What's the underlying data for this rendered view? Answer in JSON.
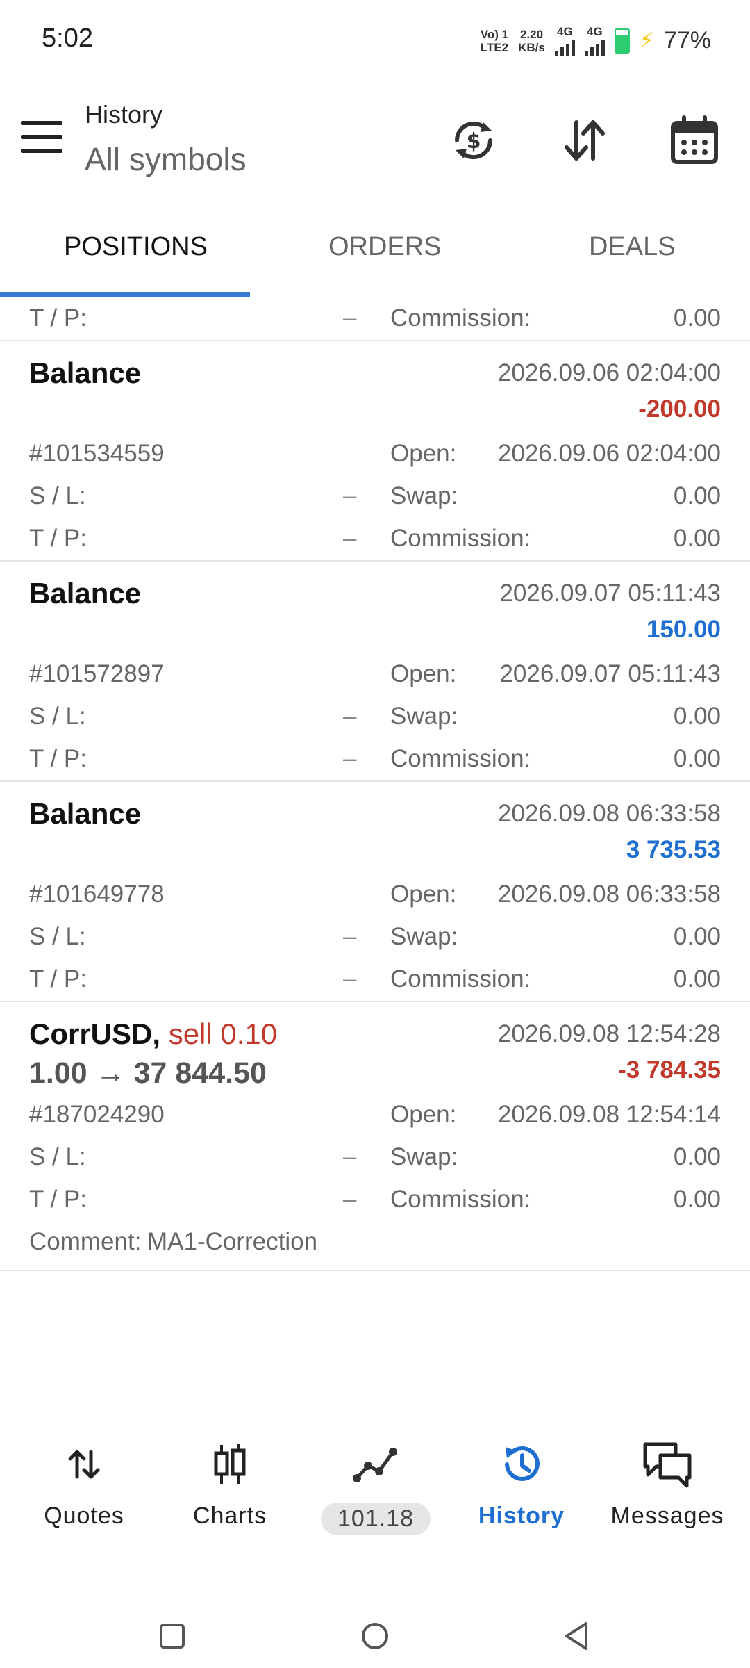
{
  "status": {
    "time": "5:02",
    "net1": "Vo) 1",
    "net1b": "LTE2",
    "speed": "2.20",
    "speed_unit": "KB/s",
    "net2": "4G",
    "net3": "4G",
    "battery_pct": "77%"
  },
  "header": {
    "title": "History",
    "subtitle": "All symbols"
  },
  "tabs": [
    "POSITIONS",
    "ORDERS",
    "DEALS"
  ],
  "active_tab": 0,
  "labels": {
    "tp": "T / P:",
    "sl": "S / L:",
    "open": "Open:",
    "swap": "Swap:",
    "commission": "Commission:",
    "dash": "–",
    "comment": "Comment:",
    "arrow": "→"
  },
  "partial_row": {
    "commission": "0.00"
  },
  "entries": [
    {
      "title": "Balance",
      "date": "2026.09.06 02:04:00",
      "amount": "-200.00",
      "ticket": "#101534559",
      "open": "2026.09.06 02:04:00",
      "swap": "0.00",
      "commission": "0.00"
    },
    {
      "title": "Balance",
      "date": "2026.09.07 05:11:43",
      "amount": "150.00",
      "ticket": "#101572897",
      "open": "2026.09.07 05:11:43",
      "swap": "0.00",
      "commission": "0.00"
    },
    {
      "title": "Balance",
      "date": "2026.09.08 06:33:58",
      "amount": "3 735.53",
      "ticket": "#101649778",
      "open": "2026.09.08 06:33:58",
      "swap": "0.00",
      "commission": "0.00"
    }
  ],
  "trade": {
    "symbol": "CorrUSD,",
    "side": "sell 0.10",
    "price_from": "1.00",
    "price_to": "37 844.50",
    "date": "2026.09.08 12:54:28",
    "amount": "-3 784.35",
    "ticket": "#187024290",
    "open": "2026.09.08 12:54:14",
    "swap": "0.00",
    "commission": "0.00",
    "comment": "MA1-Correction"
  },
  "nav": {
    "quotes": "Quotes",
    "charts": "Charts",
    "trade_value": "101.18",
    "history": "History",
    "messages": "Messages"
  },
  "colors": {
    "accent": "#1f6fd1",
    "negative": "#c0392b",
    "tab_indicator": "#3a7bd5"
  }
}
